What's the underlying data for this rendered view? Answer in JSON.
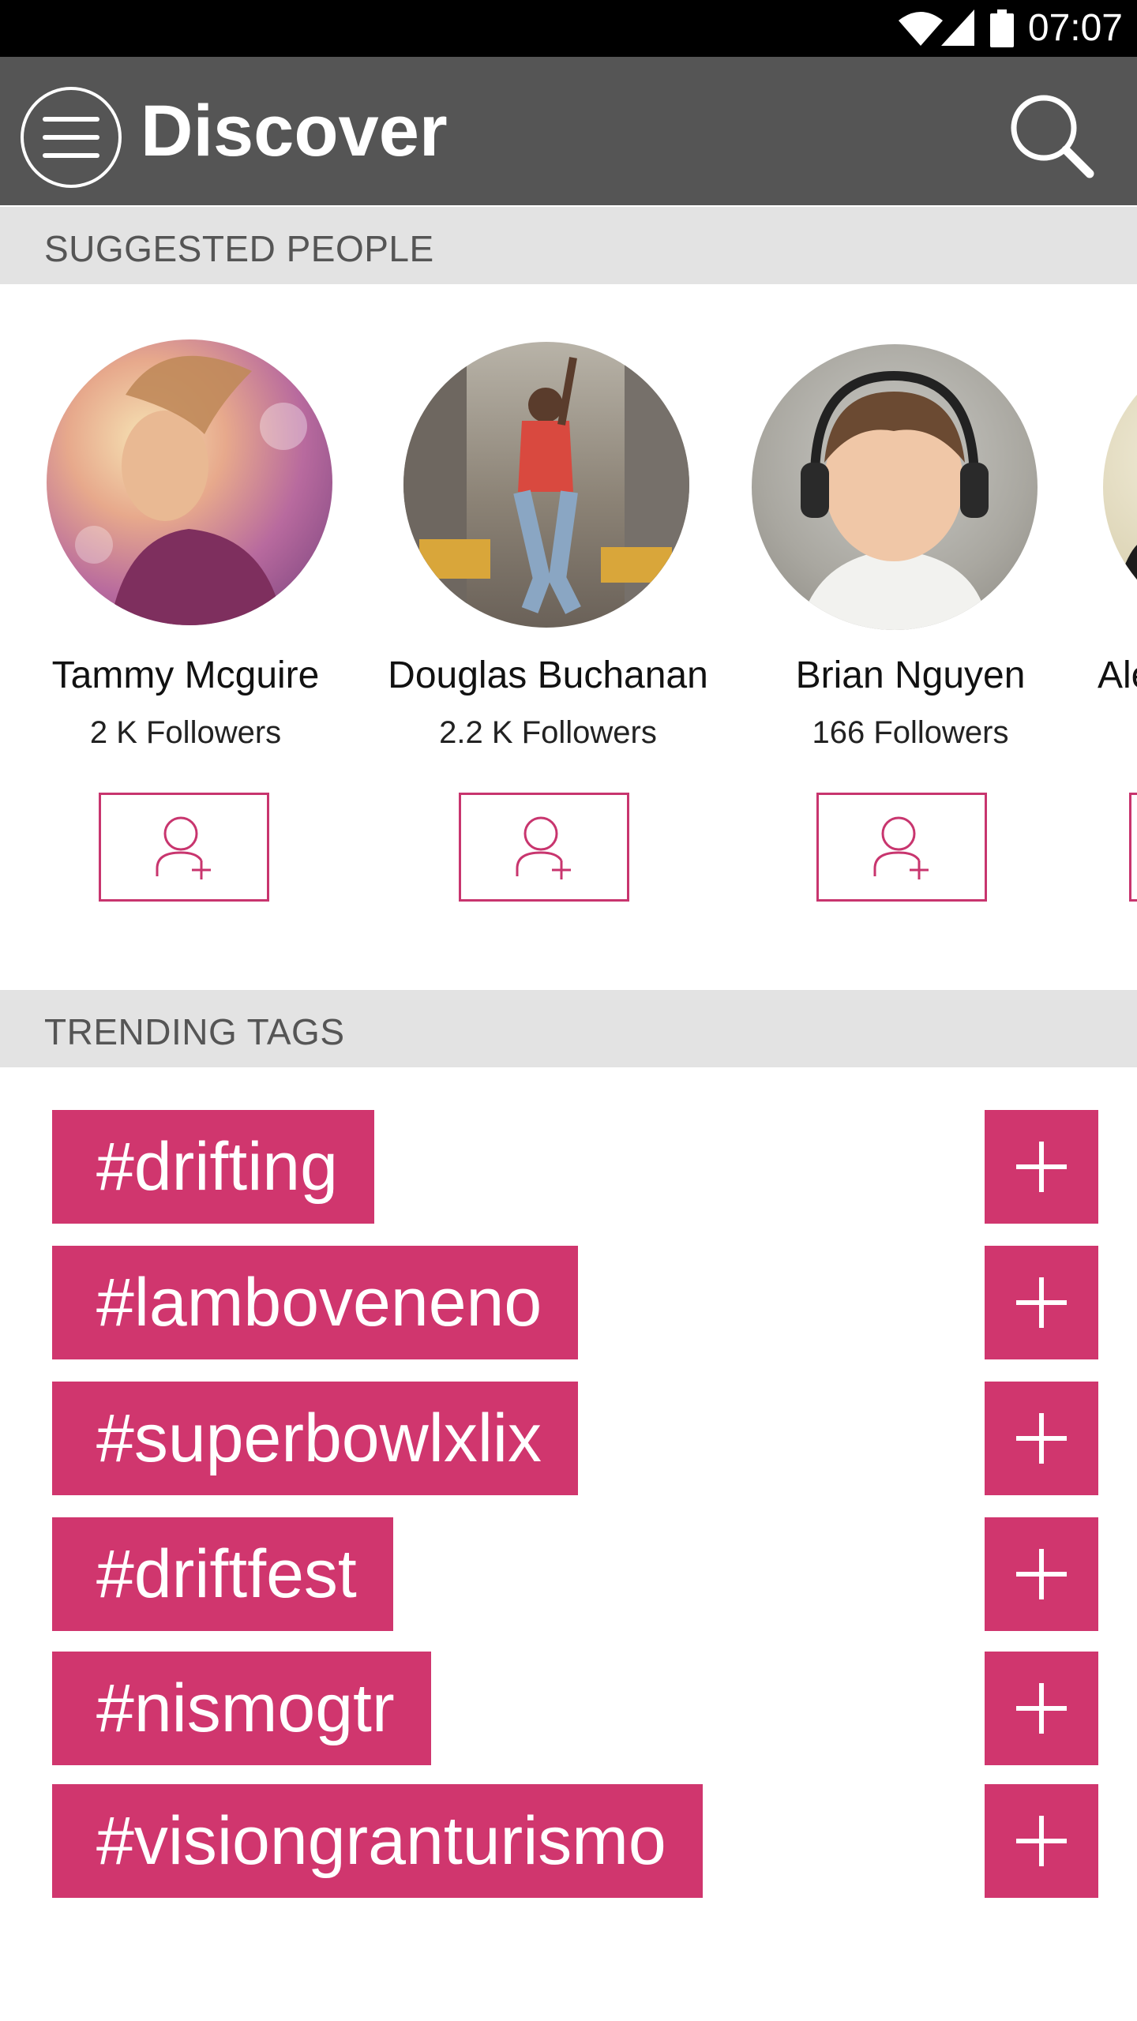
{
  "status_bar": {
    "time": "07:07"
  },
  "app_bar": {
    "title": "Discover"
  },
  "suggested": {
    "header": "SUGGESTED PEOPLE",
    "people": [
      {
        "name": "Tammy Mcguire",
        "followers": "2 K Followers"
      },
      {
        "name": "Douglas Buchanan",
        "followers": "2.2 K Followers"
      },
      {
        "name": "Brian Nguyen",
        "followers": "166 Followers"
      },
      {
        "name": "Ale",
        "followers": ""
      }
    ]
  },
  "trending": {
    "header": "TRENDING TAGS",
    "tags": [
      {
        "label": "#drifting"
      },
      {
        "label": "#lamboveneno"
      },
      {
        "label": "#superbowlxlix"
      },
      {
        "label": "#driftfest"
      },
      {
        "label": "#nismogtr"
      },
      {
        "label": "#visiongranturismo"
      }
    ]
  },
  "colors": {
    "accent": "#d0366e",
    "appbar": "#555555",
    "section_header_bg": "#e3e3e3"
  },
  "icons": [
    "wifi-icon",
    "signal-icon",
    "battery-icon",
    "menu-icon",
    "search-icon",
    "add-person-icon",
    "plus-icon"
  ]
}
